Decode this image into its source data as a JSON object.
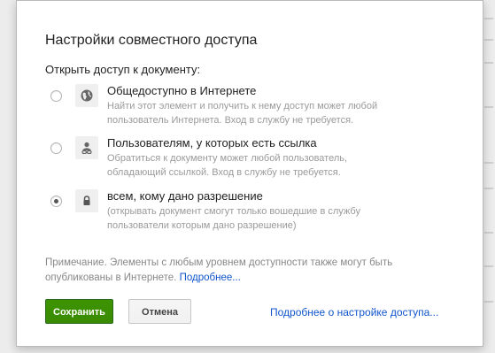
{
  "dialog": {
    "title": "Настройки совместного доступа",
    "section_label": "Открыть доступ к документу:",
    "options": [
      {
        "title": "Общедоступно в Интернете",
        "description": "Найти этот элемент и получить к нему доступ может любой пользователь Интернета. Вход в службу не требуется.",
        "icon": "globe-icon",
        "selected": false
      },
      {
        "title": "Пользователям, у которых есть ссылка",
        "description": "Обратиться к документу может любой пользователь, обладающий ссылкой. Вход в службу не требуется.",
        "icon": "link-person-icon",
        "selected": false
      },
      {
        "title": "всем, кому дано разрешение",
        "description": "(открывать документ смогут только вошедшие в службу пользователи которым дано разрешение)",
        "icon": "lock-icon",
        "selected": true
      }
    ],
    "note": {
      "text": "Примечание. Элементы с любым уровнем доступности также могут быть опубликованы в Интернете.",
      "link": "Подробнее..."
    },
    "buttons": {
      "save": "Сохранить",
      "cancel": "Отмена"
    },
    "footer_link": "Подробнее о настройке доступа...",
    "colors": {
      "save_button": "#3d9400",
      "link": "#1155cc"
    }
  }
}
